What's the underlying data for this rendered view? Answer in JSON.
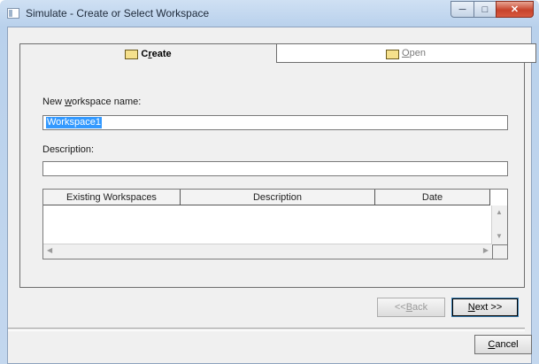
{
  "window": {
    "title": "Simulate - Create or Select Workspace"
  },
  "tabs": [
    {
      "label_pre": "C",
      "label_u": "r",
      "label_post": "eate"
    },
    {
      "label_pre": "",
      "label_u": "O",
      "label_post": "pen"
    }
  ],
  "form": {
    "workspace_label_pre": "New ",
    "workspace_label_u": "w",
    "workspace_label_post": "orkspace name:",
    "workspace_value": "Workspace1",
    "description_label": "Description:",
    "description_value": ""
  },
  "table": {
    "columns": [
      "Existing Workspaces",
      "Description",
      "Date"
    ],
    "rows": []
  },
  "buttons": {
    "back_pre": "<< ",
    "back_u": "B",
    "back_post": "ack",
    "next_u": "N",
    "next_post": "ext >>",
    "cancel_u": "C",
    "cancel_post": "ancel"
  }
}
